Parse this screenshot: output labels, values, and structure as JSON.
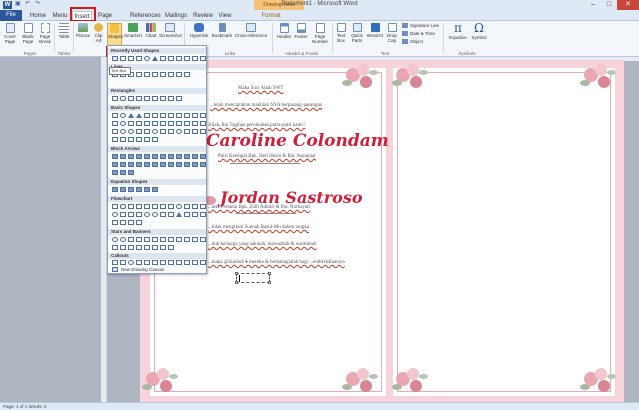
{
  "window": {
    "title": "Document1 - Microsoft Word",
    "context_tab": "Drawing Tools",
    "app_icon": "W"
  },
  "tabs": [
    "File",
    "Home",
    "Menu",
    "Insert",
    "Page Layout",
    "References",
    "Mailings",
    "Review",
    "View",
    "Format"
  ],
  "ribbon": {
    "buttons": {
      "cover_page": "Cover Page",
      "blank_page": "Blank Page",
      "page_break": "Page Break",
      "table": "Table",
      "picture": "Picture",
      "clip_art": "Clip Art",
      "shapes": "Shapes",
      "smartart": "SmartArt",
      "chart": "Chart",
      "screenshot": "Screenshot",
      "hyperlink": "Hyperlink",
      "bookmark": "Bookmark",
      "cross_reference": "Cross-reference",
      "header": "Header",
      "footer": "Footer",
      "page_number": "Page Number",
      "text_box": "Text Box",
      "quick_parts": "Quick Parts",
      "wordart": "WordArt",
      "drop_cap": "Drop Cap",
      "signature_line": "Signature Line",
      "date_time": "Date & Time",
      "object": "Object",
      "equation": "Equation",
      "symbol": "Symbol"
    },
    "groups": {
      "pages": "Pages",
      "tables": "Tables",
      "links": "Links",
      "header_footer": "Header & Footer",
      "text": "Text",
      "symbols": "Symbols"
    }
  },
  "shapes_menu": {
    "sections": [
      "Recently Used Shapes",
      "Lines",
      "Rectangles",
      "Basic Shapes",
      "Block Arrows",
      "Equation Shapes",
      "Flowchart",
      "Stars and Banners",
      "Callouts"
    ],
    "tooltip": "Text Box",
    "new_canvas": "New Drawing Canvas"
  },
  "document": {
    "line1": "Maha Suci Allah SWT",
    "line2": "...telah menciptakan makhluk NYA berpasang-pasangan",
    "line3": "Allah, Ibu Tagihan pernikahan putra-putri kami :",
    "bride_name": "Caroline Colondam",
    "bride_parents": "Putri Keempat Bpk. Heri Husin & Ibu. Asmaniar",
    "groom_name": "Jordan Sastroso",
    "groom_parents": "...utra Pertama Bpk. Zulll Admiri & Ibu. Nurhayati",
    "line4": "...tidak mengikuti Sunnah Rasul-Mu dalam rangka",
    "line5": "...duk keluarga yang sakinah, mawaddah & warahmah",
    "line6": "...maka @ikasbuh ♦ mereka & berbahagialah bagi ...emberkahannya"
  },
  "status": {
    "text": "Page: 1 of 1   Words: 0"
  }
}
